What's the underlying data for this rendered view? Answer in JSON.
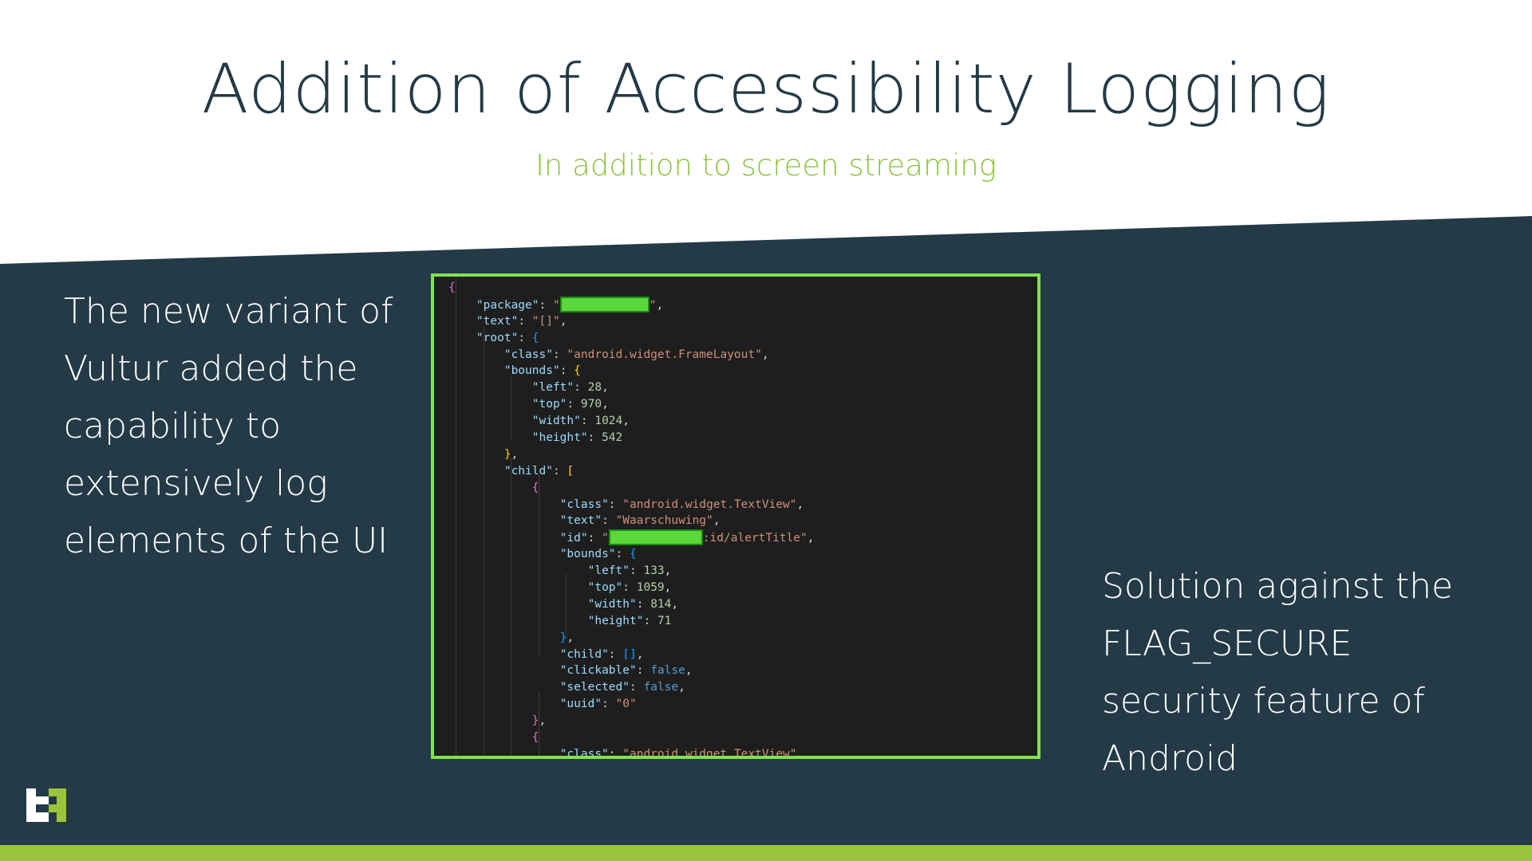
{
  "slide": {
    "title": "Addition of Accessibility Logging",
    "subtitle": "In addition to screen streaming",
    "left_text_lines": [
      "The new variant of",
      "Vultur added the",
      "capability to",
      "extensively log",
      "elements of the UI"
    ],
    "right_text_lines": [
      "Solution against the",
      "FLAG_SECURE",
      "security feature of",
      "Android"
    ],
    "colors": {
      "title": "#243a46",
      "accent": "#8cc43c",
      "dark_bg": "#243a46",
      "code_border": "#7fe34a",
      "redaction": "#5ad83a"
    }
  },
  "code": {
    "package_key": "\"package\"",
    "text_key": "\"text\"",
    "text_val": "\"[]\"",
    "root_key": "\"root\"",
    "class_key": "\"class\"",
    "framelayout_val": "\"android.widget.FrameLayout\"",
    "bounds_key": "\"bounds\"",
    "left_key": "\"left\"",
    "left_val": "28",
    "top_key": "\"top\"",
    "top_val": "970",
    "width_key": "\"width\"",
    "width_val": "1024",
    "height_key": "\"height\"",
    "height_val": "542",
    "child_key": "\"child\"",
    "textview_val": "\"android.widget.TextView\"",
    "child_text_val": "\"Waarschuwing\"",
    "id_key": "\"id\"",
    "id_suffix": ":id/alertTitle\"",
    "c_left_val": "133",
    "c_top_val": "1059",
    "c_width_val": "814",
    "c_height_val": "71",
    "child_empty": "[]",
    "clickable_key": "\"clickable\"",
    "clickable_val": "false",
    "selected_key": "\"selected\"",
    "selected_val": "false",
    "uuid_key": "\"uuid\"",
    "uuid_val": "\"0\""
  },
  "logo": {
    "icon": "company-logo-icon"
  }
}
